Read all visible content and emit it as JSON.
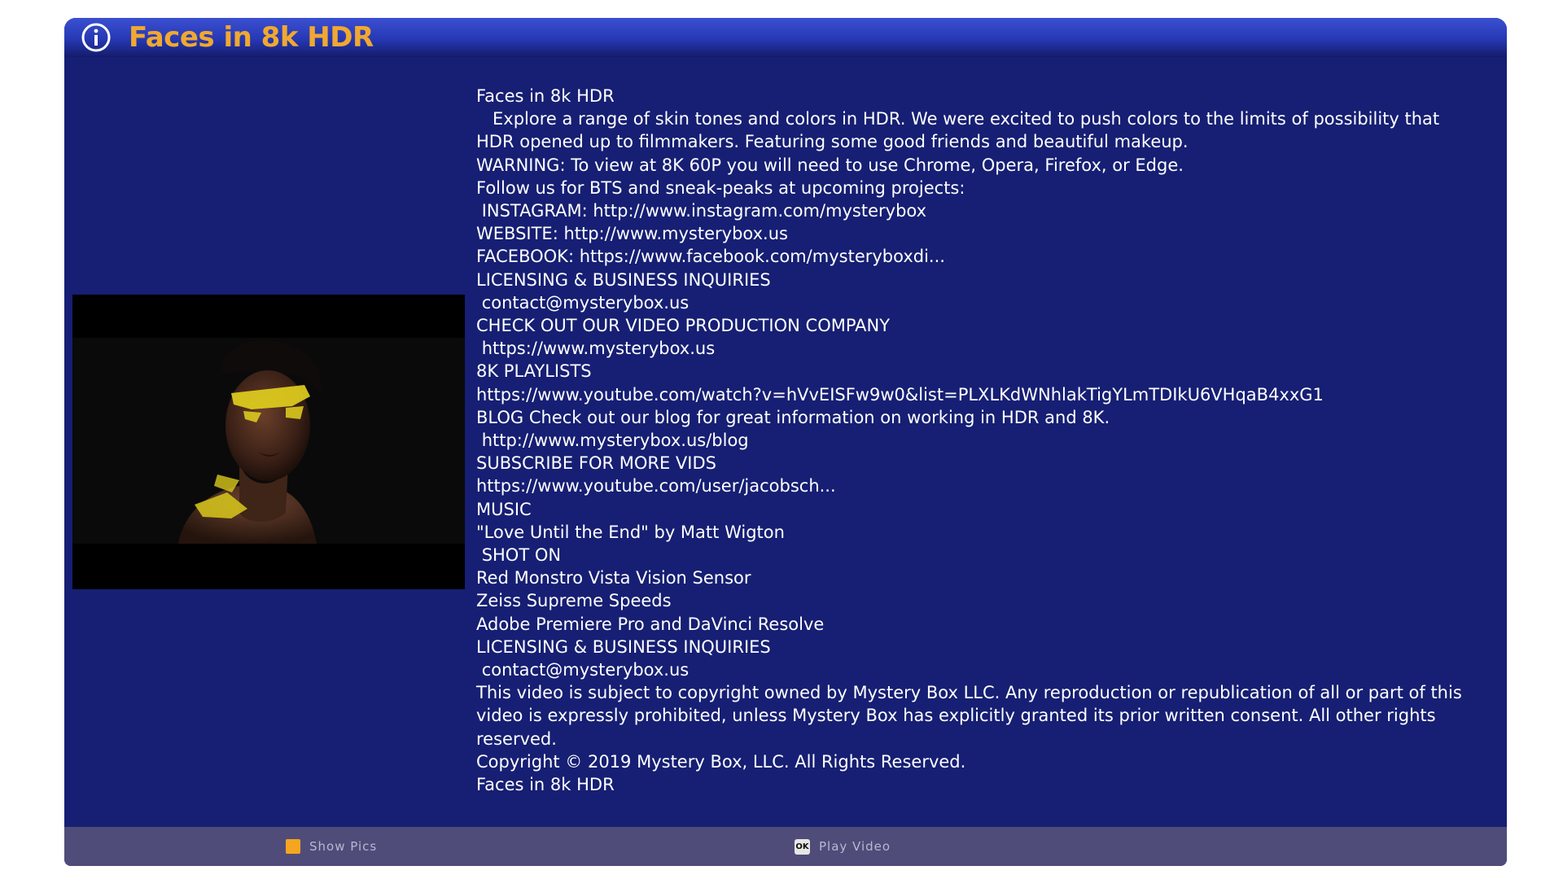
{
  "dialog": {
    "title": "Faces in 8k HDR",
    "title_icon": "info-icon",
    "accent_color": "#f0a830",
    "background_color": "#161f73"
  },
  "thumbnail": {
    "subject": "woman-with-yellow-face-paint"
  },
  "description_lines": [
    "Faces in 8k HDR",
    "   Explore a range of skin tones and colors in HDR. We were excited to push colors to the limits of possibility that",
    "HDR opened up to filmmakers. Featuring some good friends and beautiful makeup.",
    "WARNING: To view at 8K 60P you will need to use Chrome, Opera, Firefox, or Edge.",
    "Follow us for BTS and sneak-peaks at upcoming projects:",
    " INSTAGRAM: http://www.instagram.com/mysterybox",
    "WEBSITE: http://www.mysterybox.us",
    "FACEBOOK: https://www.facebook.com/mysteryboxdi...",
    "LICENSING & BUSINESS INQUIRIES",
    " contact@mysterybox.us",
    "CHECK OUT OUR VIDEO PRODUCTION COMPANY",
    " https://www.mysterybox.us",
    "8K PLAYLISTS",
    "https://www.youtube.com/watch?v=hVvEISFw9w0&list=PLXLKdWNhlakTigYLmTDIkU6VHqaB4xxG1",
    "BLOG Check out our blog for great information on working in HDR and 8K.",
    " http://www.mysterybox.us/blog",
    "SUBSCRIBE FOR MORE VIDS",
    "https://www.youtube.com/user/jacobsch...",
    "MUSIC",
    "\"Love Until the End\" by Matt Wigton",
    " SHOT ON",
    "Red Monstro Vista Vision Sensor",
    "Zeiss Supreme Speeds",
    "Adobe Premiere Pro and DaVinci Resolve",
    "LICENSING & BUSINESS INQUIRIES",
    " contact@mysterybox.us",
    "This video is subject to copyright owned by Mystery Box LLC. Any reproduction or republication of all or part of this",
    "video is expressly prohibited, unless Mystery Box has explicitly granted its prior written consent. All other rights",
    "reserved.",
    "Copyright © 2019 Mystery Box, LLC. All Rights Reserved.",
    "Faces in 8k HDR"
  ],
  "footer": {
    "show_pics": {
      "label": "Show Pics",
      "key_color": "#f5a51f"
    },
    "play_video": {
      "label": "Play Video",
      "key_label": "OK"
    }
  }
}
